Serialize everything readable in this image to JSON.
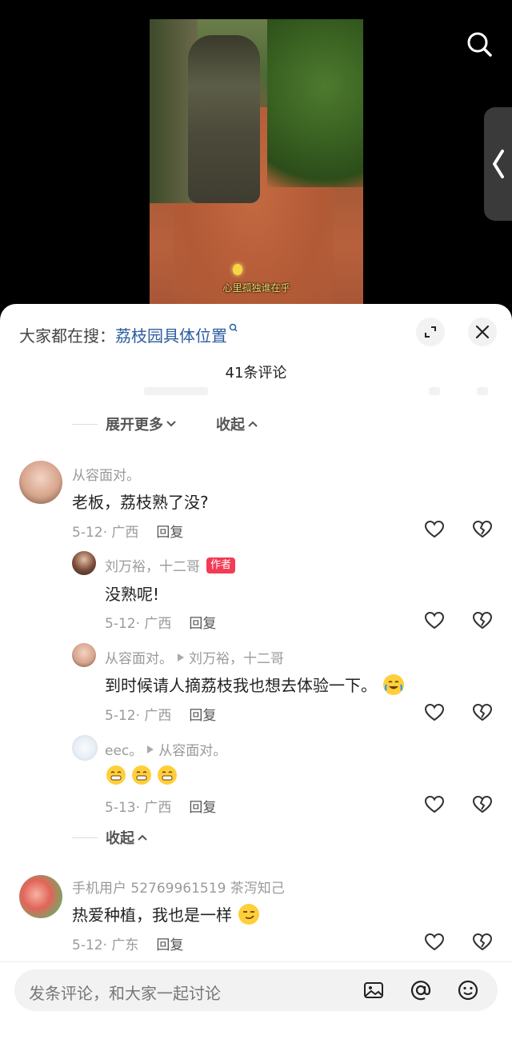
{
  "video": {
    "caption": "心里孤独谁在乎"
  },
  "sheet": {
    "trend_prefix": "大家都在搜：",
    "trend_keyword": "荔枝园具体位置",
    "comment_count": "41条评论"
  },
  "controls_top": {
    "expand_more": "展开更多",
    "collapse": "收起"
  },
  "comments": [
    {
      "author": "从容面对。",
      "text": "老板，荔枝熟了没?",
      "date_loc": "5-12· 广西",
      "reply": "回复"
    },
    {
      "author": "刘万裕，十二哥",
      "badge": "作者",
      "text": "没熟呢!",
      "date_loc": "5-12· 广西",
      "reply": "回复"
    },
    {
      "author": "从容面对。",
      "reply_to": "刘万裕，十二哥",
      "text": "到时候请人摘荔枝我也想去体验一下。",
      "date_loc": "5-12· 广西",
      "reply": "回复"
    },
    {
      "author": "eec。",
      "reply_to": "从容面对。",
      "text": "",
      "date_loc": "5-13· 广西",
      "reply": "回复"
    },
    {
      "author": "手机用户 52769961519 茶泻知己",
      "text": "热爱种植，我也是一样",
      "date_loc": "5-12· 广东",
      "reply": "回复"
    }
  ],
  "controls_bottom": {
    "collapse": "收起"
  },
  "input": {
    "placeholder": "发条评论，和大家一起讨论"
  },
  "icons": {
    "search": "search-icon",
    "side_handle": "chevron-left-icon",
    "expand": "expand-icon",
    "close": "close-icon",
    "like": "heart-icon",
    "dislike": "broken-heart-icon",
    "image": "image-icon",
    "mention": "at-icon",
    "emoji": "smiley-icon"
  },
  "colors": {
    "accent_link": "#2b5b9f",
    "author_badge": "#f23c55",
    "muted": "#9a9a9a"
  }
}
